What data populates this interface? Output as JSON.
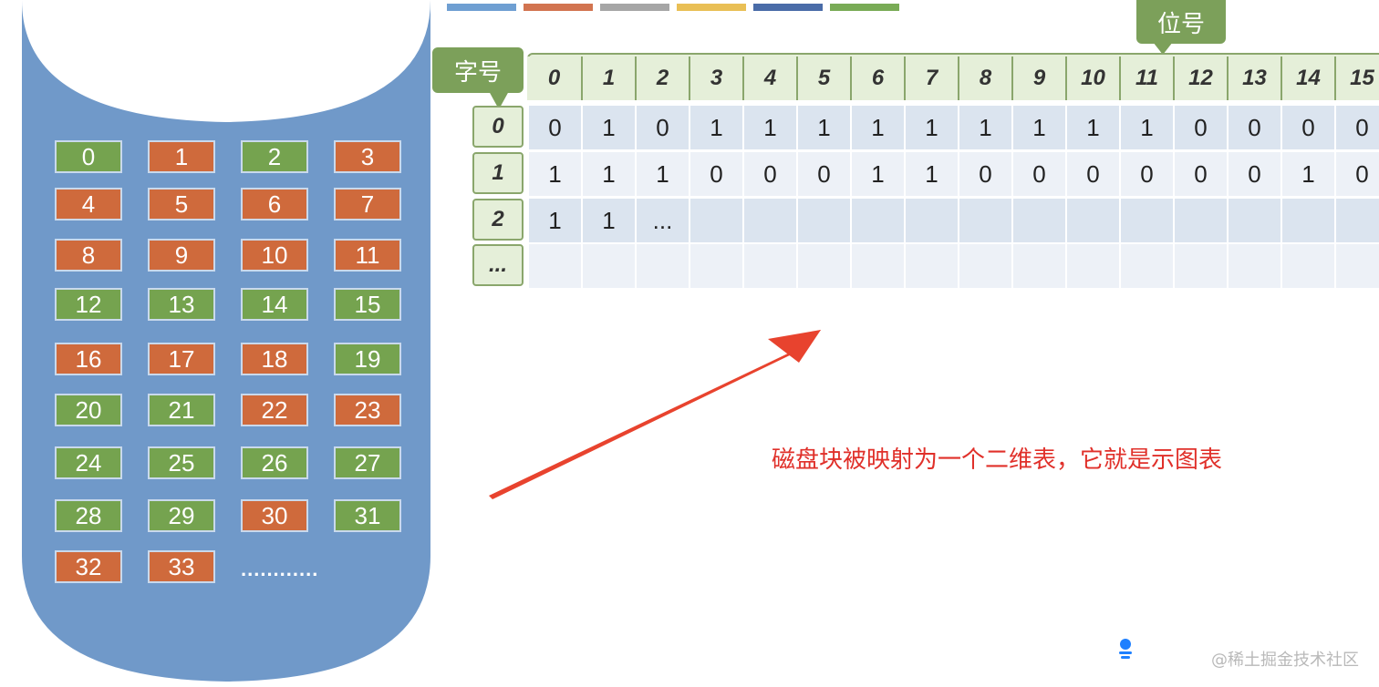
{
  "disk": {
    "blocks": [
      {
        "n": "0",
        "c": "g"
      },
      {
        "n": "1",
        "c": "o"
      },
      {
        "n": "2",
        "c": "g"
      },
      {
        "n": "3",
        "c": "o"
      },
      {
        "n": "4",
        "c": "o"
      },
      {
        "n": "5",
        "c": "o"
      },
      {
        "n": "6",
        "c": "o"
      },
      {
        "n": "7",
        "c": "o"
      },
      {
        "n": "8",
        "c": "o"
      },
      {
        "n": "9",
        "c": "o"
      },
      {
        "n": "10",
        "c": "o"
      },
      {
        "n": "11",
        "c": "o"
      },
      {
        "n": "12",
        "c": "g"
      },
      {
        "n": "13",
        "c": "g"
      },
      {
        "n": "14",
        "c": "g"
      },
      {
        "n": "15",
        "c": "g"
      },
      {
        "n": "16",
        "c": "o"
      },
      {
        "n": "17",
        "c": "o"
      },
      {
        "n": "18",
        "c": "o"
      },
      {
        "n": "19",
        "c": "g"
      },
      {
        "n": "20",
        "c": "g"
      },
      {
        "n": "21",
        "c": "g"
      },
      {
        "n": "22",
        "c": "o"
      },
      {
        "n": "23",
        "c": "o"
      },
      {
        "n": "24",
        "c": "g"
      },
      {
        "n": "25",
        "c": "g"
      },
      {
        "n": "26",
        "c": "g"
      },
      {
        "n": "27",
        "c": "g"
      },
      {
        "n": "28",
        "c": "g"
      },
      {
        "n": "29",
        "c": "g"
      },
      {
        "n": "30",
        "c": "o"
      },
      {
        "n": "31",
        "c": "g"
      },
      {
        "n": "32",
        "c": "o"
      },
      {
        "n": "33",
        "c": "o"
      }
    ],
    "ellipsis": "............",
    "colors": {
      "body": "#7099c9",
      "free": "#75a34f",
      "used": "#cf6a3c"
    }
  },
  "legend_colors": [
    "#6f9fd2",
    "#d27450",
    "#a6a6a6",
    "#e9bf55",
    "#4a6ca8",
    "#79ab56"
  ],
  "table": {
    "word_label": "字号",
    "bit_label": "位号",
    "column_headers": [
      "0",
      "1",
      "2",
      "3",
      "4",
      "5",
      "6",
      "7",
      "8",
      "9",
      "10",
      "11",
      "12",
      "13",
      "14",
      "15"
    ],
    "row_headers": [
      "0",
      "1",
      "2",
      "..."
    ],
    "rows": [
      [
        "0",
        "1",
        "0",
        "1",
        "1",
        "1",
        "1",
        "1",
        "1",
        "1",
        "1",
        "1",
        "0",
        "0",
        "0",
        "0"
      ],
      [
        "1",
        "1",
        "1",
        "0",
        "0",
        "0",
        "1",
        "1",
        "0",
        "0",
        "0",
        "0",
        "0",
        "0",
        "1",
        "0"
      ],
      [
        "1",
        "1",
        "...",
        "",
        "",
        "",
        "",
        "",
        "",
        "",
        "",
        "",
        "",
        "",
        "",
        ""
      ],
      [
        "",
        "",
        "",
        "",
        "",
        "",
        "",
        "",
        "",
        "",
        "",
        "",
        "",
        "",
        "",
        ""
      ]
    ]
  },
  "annotation": "磁盘块被映射为一个二维表，它就是示图表",
  "watermark": "@稀土掘金技术社区"
}
